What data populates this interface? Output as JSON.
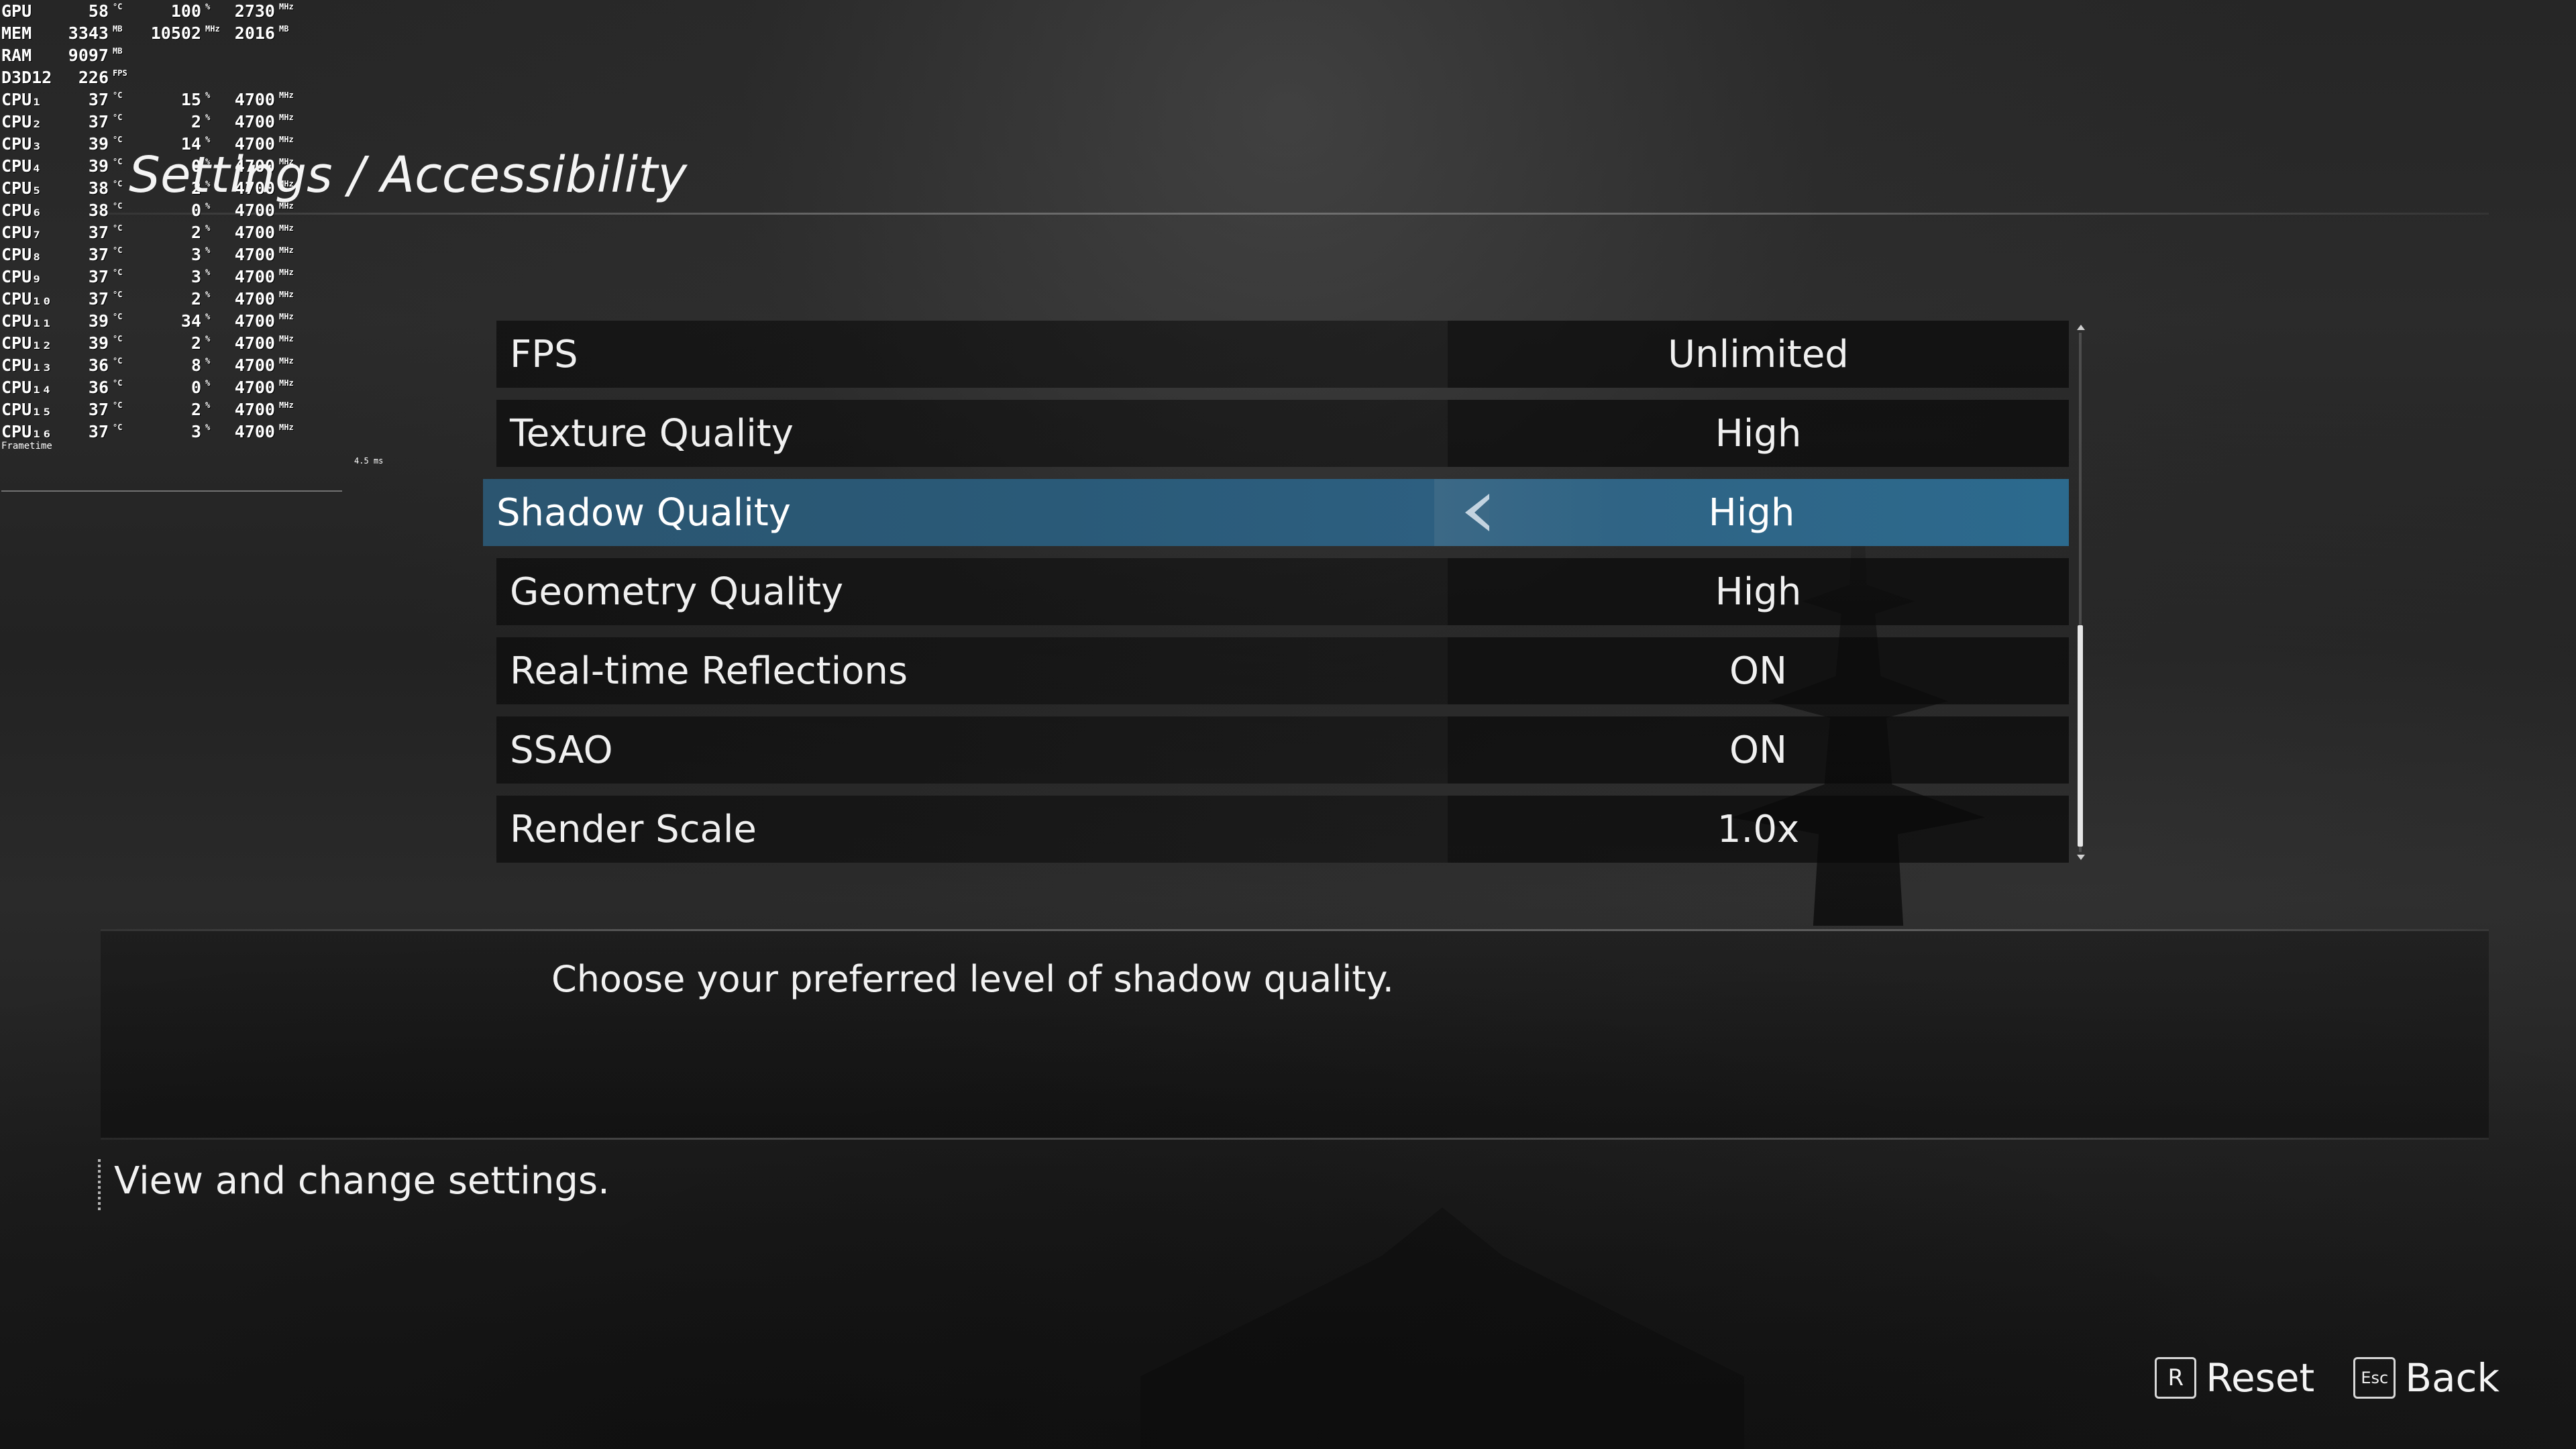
{
  "osd": {
    "rows": [
      {
        "label": "GPU",
        "v1": "58",
        "u1": "°C",
        "v2": "100",
        "u2": "%",
        "v3": "2730",
        "u3": "MHz"
      },
      {
        "label": "MEM",
        "v1": "3343",
        "u1": "MB",
        "v2": "10502",
        "u2": "MHz",
        "v3": "2016",
        "u3": "MB"
      },
      {
        "label": "RAM",
        "v1": "9097",
        "u1": "MB",
        "v2": "",
        "u2": "",
        "v3": "",
        "u3": ""
      },
      {
        "label": "D3D12",
        "v1": "226",
        "u1": "FPS",
        "v2": "",
        "u2": "",
        "v3": "",
        "u3": ""
      },
      {
        "label": "CPU₁",
        "v1": "37",
        "u1": "°C",
        "v2": "15",
        "u2": "%",
        "v3": "4700",
        "u3": "MHz"
      },
      {
        "label": "CPU₂",
        "v1": "37",
        "u1": "°C",
        "v2": "2",
        "u2": "%",
        "v3": "4700",
        "u3": "MHz"
      },
      {
        "label": "CPU₃",
        "v1": "39",
        "u1": "°C",
        "v2": "14",
        "u2": "%",
        "v3": "4700",
        "u3": "MHz"
      },
      {
        "label": "CPU₄",
        "v1": "39",
        "u1": "°C",
        "v2": "0",
        "u2": "%",
        "v3": "4700",
        "u3": "MHz"
      },
      {
        "label": "CPU₅",
        "v1": "38",
        "u1": "°C",
        "v2": "2",
        "u2": "%",
        "v3": "4700",
        "u3": "MHz"
      },
      {
        "label": "CPU₆",
        "v1": "38",
        "u1": "°C",
        "v2": "0",
        "u2": "%",
        "v3": "4700",
        "u3": "MHz"
      },
      {
        "label": "CPU₇",
        "v1": "37",
        "u1": "°C",
        "v2": "2",
        "u2": "%",
        "v3": "4700",
        "u3": "MHz"
      },
      {
        "label": "CPU₈",
        "v1": "37",
        "u1": "°C",
        "v2": "3",
        "u2": "%",
        "v3": "4700",
        "u3": "MHz"
      },
      {
        "label": "CPU₉",
        "v1": "37",
        "u1": "°C",
        "v2": "3",
        "u2": "%",
        "v3": "4700",
        "u3": "MHz"
      },
      {
        "label": "CPU₁₀",
        "v1": "37",
        "u1": "°C",
        "v2": "2",
        "u2": "%",
        "v3": "4700",
        "u3": "MHz"
      },
      {
        "label": "CPU₁₁",
        "v1": "39",
        "u1": "°C",
        "v2": "34",
        "u2": "%",
        "v3": "4700",
        "u3": "MHz"
      },
      {
        "label": "CPU₁₂",
        "v1": "39",
        "u1": "°C",
        "v2": "2",
        "u2": "%",
        "v3": "4700",
        "u3": "MHz"
      },
      {
        "label": "CPU₁₃",
        "v1": "36",
        "u1": "°C",
        "v2": "8",
        "u2": "%",
        "v3": "4700",
        "u3": "MHz"
      },
      {
        "label": "CPU₁₄",
        "v1": "36",
        "u1": "°C",
        "v2": "0",
        "u2": "%",
        "v3": "4700",
        "u3": "MHz"
      },
      {
        "label": "CPU₁₅",
        "v1": "37",
        "u1": "°C",
        "v2": "2",
        "u2": "%",
        "v3": "4700",
        "u3": "MHz"
      },
      {
        "label": "CPU₁₆",
        "v1": "37",
        "u1": "°C",
        "v2": "3",
        "u2": "%",
        "v3": "4700",
        "u3": "MHz"
      }
    ],
    "frametime_label": "Frametime",
    "frametime_value": "4.5 ms"
  },
  "header": {
    "title": "Settings / Accessibility"
  },
  "settings": {
    "items": [
      {
        "label": "FPS",
        "value": "Unlimited",
        "selected": false
      },
      {
        "label": "Texture Quality",
        "value": "High",
        "selected": false
      },
      {
        "label": "Shadow Quality",
        "value": "High",
        "selected": true
      },
      {
        "label": "Geometry Quality",
        "value": "High",
        "selected": false
      },
      {
        "label": "Real-time Reflections",
        "value": "ON",
        "selected": false
      },
      {
        "label": "SSAO",
        "value": "ON",
        "selected": false
      },
      {
        "label": "Render Scale",
        "value": "1.0x",
        "selected": false
      }
    ]
  },
  "description": {
    "text": "Choose your preferred level of shadow quality."
  },
  "help": {
    "text": "View and change settings."
  },
  "footer": {
    "reset_key": "R",
    "reset_label": "Reset",
    "back_key": "Esc",
    "back_label": "Back"
  },
  "colors": {
    "selected_row": "#2a5a78",
    "background": "#222222",
    "text": "#f2f2f2"
  }
}
